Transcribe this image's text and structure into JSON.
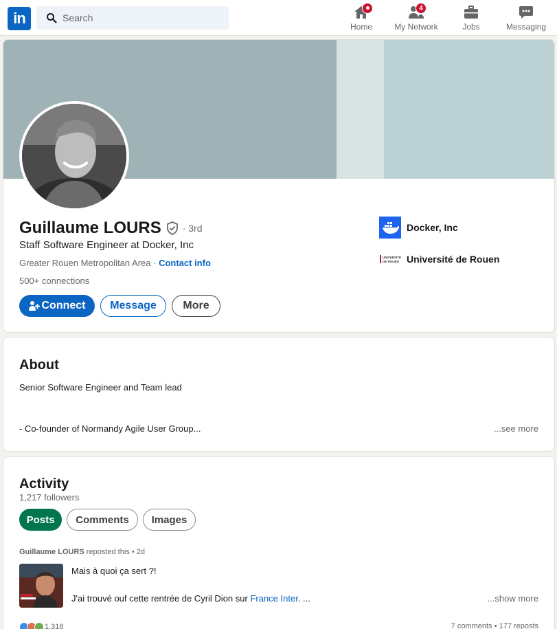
{
  "nav": {
    "logo_text": "in",
    "search_placeholder": "Search",
    "items": [
      {
        "label": "Home",
        "icon": "home-icon",
        "badge": ""
      },
      {
        "label": "My Network",
        "icon": "network-icon",
        "badge": "4"
      },
      {
        "label": "Jobs",
        "icon": "briefcase-icon",
        "badge": ""
      },
      {
        "label": "Messaging",
        "icon": "messaging-icon",
        "badge": ""
      }
    ]
  },
  "profile": {
    "name": "Guillaume LOURS",
    "degree": "· 3rd",
    "headline": "Staff Software Engineer at Docker, Inc",
    "location": "Greater Rouen Metropolitan Area",
    "separator": " · ",
    "contact_info": "Contact info",
    "connections": "500+ connections",
    "buttons": {
      "connect": "Connect",
      "message": "Message",
      "more": "More"
    },
    "orgs": [
      {
        "name": "Docker, Inc",
        "logo": "docker-logo"
      },
      {
        "name": "Université de Rouen",
        "logo": "universite-rouen-logo",
        "logo_text": "UNIVERSITÉ DE ROUEN"
      }
    ]
  },
  "about": {
    "title": "About",
    "line1": "Senior Software Engineer and Team lead",
    "line2": "- Co-founder of Normandy Agile User Group...",
    "see_more": "...see more"
  },
  "activity": {
    "title": "Activity",
    "followers": "1,217 followers",
    "tabs": [
      "Posts",
      "Comments",
      "Images"
    ],
    "post": {
      "author": "Guillaume LOURS",
      "meta": " reposted this • 2d",
      "line1": "Mais à quoi ça sert ?!",
      "line2_prefix": "J'ai trouvé ouf cette rentrée de Cyril Dion sur ",
      "line2_link": "France Inter",
      "line2_suffix": ". ...",
      "show_more": "...show more",
      "reactions": "1,318",
      "stats": "7 comments • 177 reposts"
    }
  },
  "colors": {
    "brand": "#0a66c2",
    "posts_pill": "#01754f",
    "badge": "#cb112d"
  }
}
